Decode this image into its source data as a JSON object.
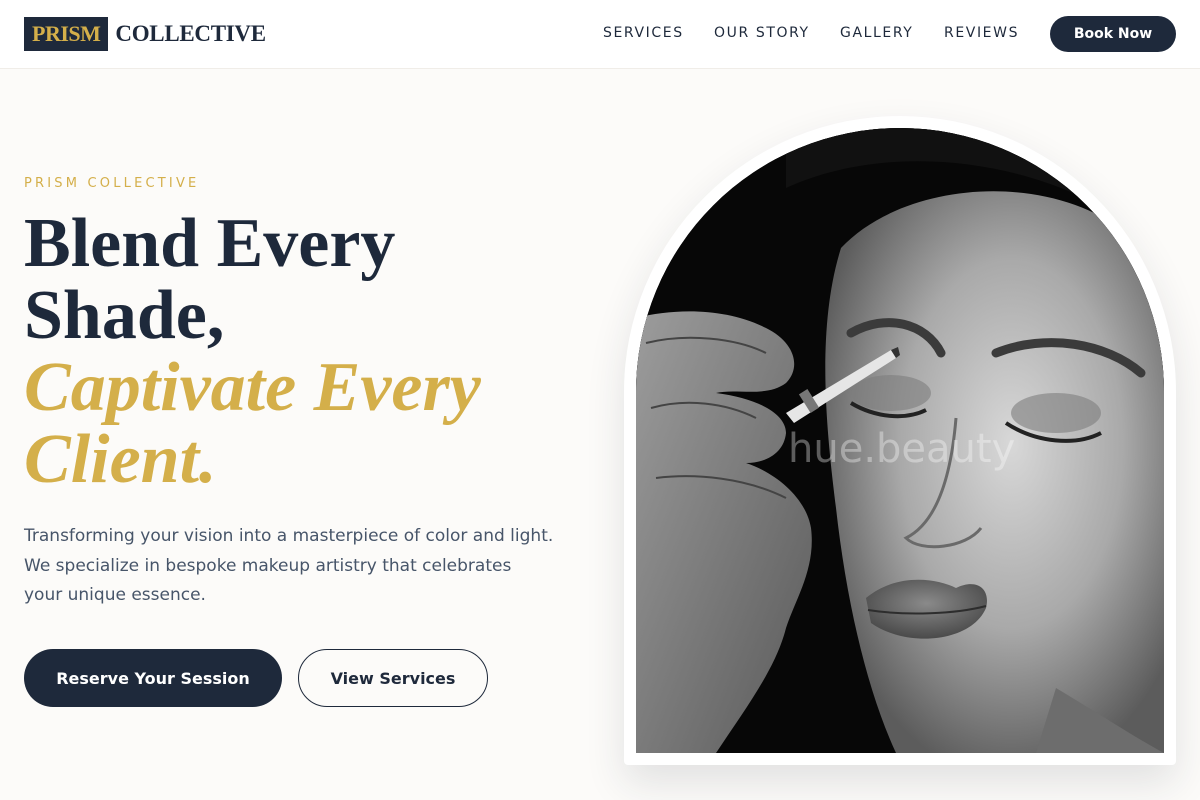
{
  "brand": {
    "mark": "PRISM",
    "word": "COLLECTIVE"
  },
  "nav": {
    "items": [
      {
        "label": "SERVICES"
      },
      {
        "label": "OUR STORY"
      },
      {
        "label": "GALLERY"
      },
      {
        "label": "REVIEWS"
      }
    ],
    "cta": "Book Now"
  },
  "hero": {
    "eyebrow": "PRISM COLLECTIVE",
    "headline": {
      "line1": "Blend Every",
      "line2": "Shade,",
      "accent1": "Captivate Every",
      "accent2": "Client."
    },
    "lede": "Transforming your vision into a masterpiece of color and light. We specialize in bespoke makeup artistry that celebrates your unique essence.",
    "primary_cta": "Reserve Your Session",
    "secondary_cta": "View Services",
    "image_watermark": "hue.beauty"
  },
  "colors": {
    "navy": "#1e293b",
    "gold": "#d4af4a",
    "background": "#fcfbf9",
    "body_text": "#475569"
  }
}
